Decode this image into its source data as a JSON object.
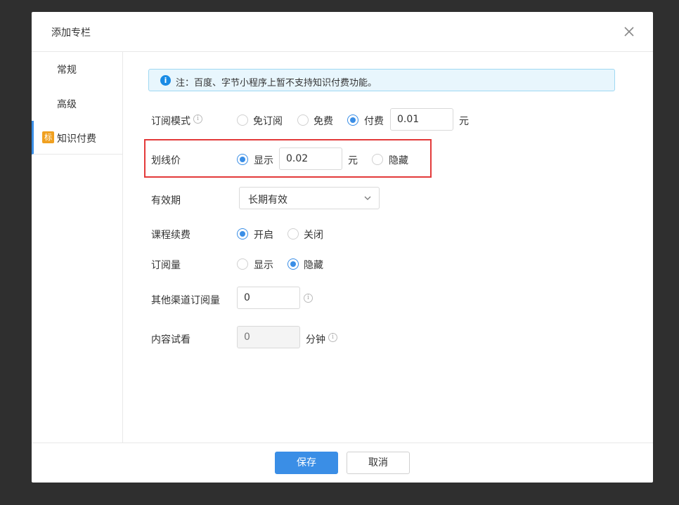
{
  "dialog": {
    "title": "添加专栏",
    "close_icon": "close-icon"
  },
  "sidebar": {
    "items": [
      {
        "label": "常规"
      },
      {
        "label": "高级"
      },
      {
        "label": "知识付费",
        "badge": "标"
      }
    ]
  },
  "notice": {
    "icon": "info-icon",
    "text": "注：百度、字节小程序上暂不支持知识付费功能。"
  },
  "form": {
    "subscribe_mode": {
      "label": "订阅模式",
      "options": [
        "免订阅",
        "免费",
        "付费"
      ],
      "selected": "付费",
      "price": "0.01",
      "unit": "元"
    },
    "strike_price": {
      "label": "划线价",
      "show_label": "显示",
      "price": "0.02",
      "unit": "元",
      "hide_label": "隐藏",
      "selected": "显示"
    },
    "validity": {
      "label": "有效期",
      "value": "长期有效"
    },
    "renewal": {
      "label": "课程续费",
      "options": [
        "开启",
        "关闭"
      ],
      "selected": "开启"
    },
    "sub_count": {
      "label": "订阅量",
      "options": [
        "显示",
        "隐藏"
      ],
      "selected": "隐藏"
    },
    "other_channel": {
      "label": "其他渠道订阅量",
      "value": "0"
    },
    "trial": {
      "label": "内容试看",
      "placeholder": "0",
      "unit": "分钟"
    }
  },
  "footer": {
    "save_label": "保存",
    "cancel_label": "取消"
  },
  "colors": {
    "primary": "#3a8ee6",
    "highlight": "#e33a3a",
    "badge": "#f0a020"
  }
}
